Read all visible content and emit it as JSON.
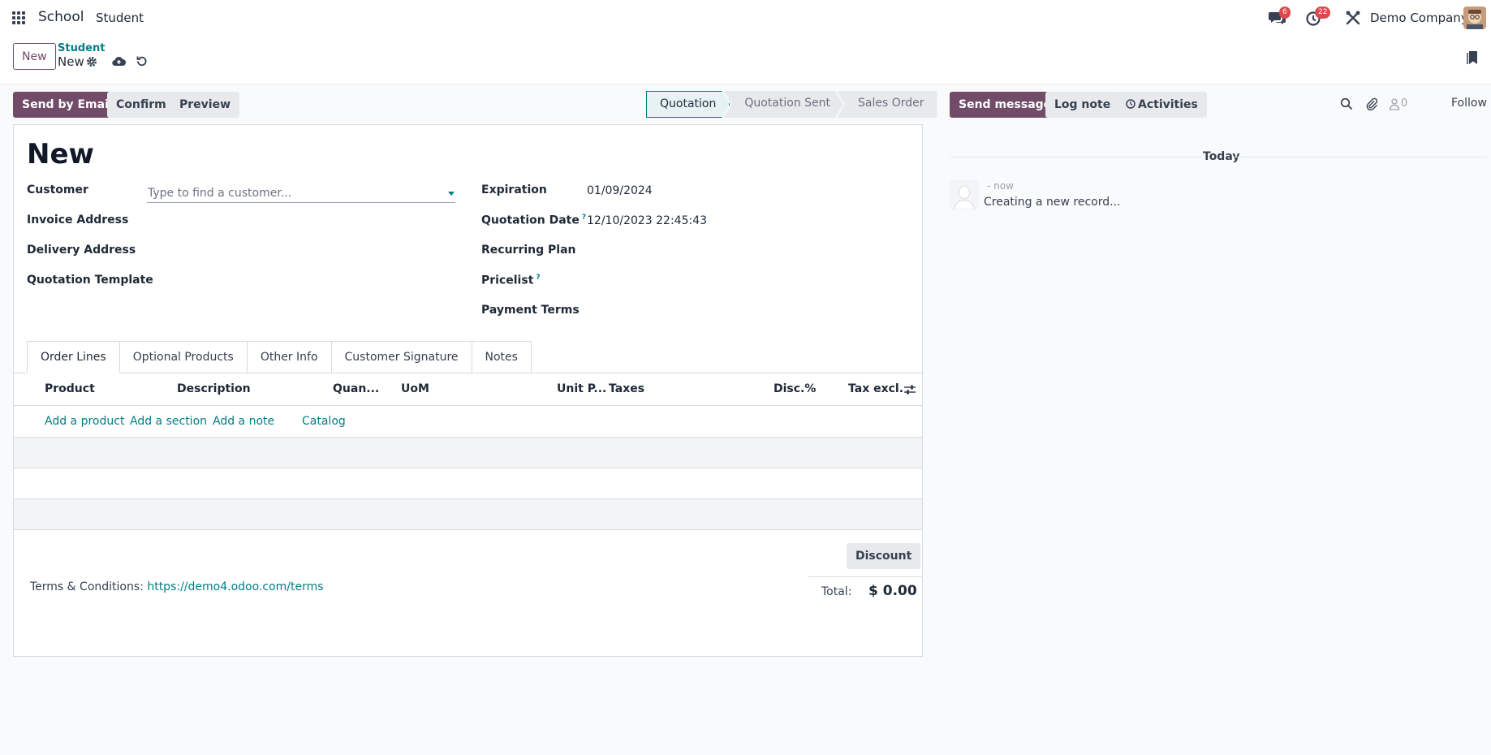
{
  "topbar": {
    "brand": "School",
    "menu_item": "Student",
    "messages_count": "6",
    "activities_count": "22",
    "company": "Demo Company"
  },
  "controlbar": {
    "new_button": "New",
    "breadcrumb_parent": "Student",
    "breadcrumb_current": "New"
  },
  "actions": {
    "send_email": "Send by Email",
    "confirm": "Confirm",
    "preview": "Preview"
  },
  "status": {
    "stages": [
      "Quotation",
      "Quotation Sent",
      "Sales Order"
    ],
    "active": "Quotation"
  },
  "form": {
    "title": "New",
    "customer_label": "Customer",
    "customer_placeholder": "Type to find a customer...",
    "invoice_address_label": "Invoice Address",
    "delivery_address_label": "Delivery Address",
    "quotation_template_label": "Quotation Template",
    "expiration_label": "Expiration",
    "expiration_value": "01/09/2024",
    "quotation_date_label": "Quotation Date",
    "quotation_date_value": "12/10/2023 22:45:43",
    "recurring_plan_label": "Recurring Plan",
    "pricelist_label": "Pricelist",
    "payment_terms_label": "Payment Terms",
    "help_mark": "?"
  },
  "tabs": [
    "Order Lines",
    "Optional Products",
    "Other Info",
    "Customer Signature",
    "Notes"
  ],
  "table": {
    "columns": [
      "Product",
      "Description",
      "Quan...",
      "UoM",
      "Unit P...",
      "Taxes",
      "Disc.%",
      "Tax excl."
    ],
    "add_links": [
      "Add a product",
      "Add a section",
      "Add a note",
      "Catalog"
    ]
  },
  "footer": {
    "discount_button": "Discount",
    "total_label": "Total:",
    "total_value": "$ 0.00",
    "terms_label": "Terms & Conditions:",
    "terms_link": "https://demo4.odoo.com/terms"
  },
  "chatter": {
    "send_message": "Send message",
    "log_note": "Log note",
    "activities": "Activities",
    "followers_count": "0",
    "follow": "Follow",
    "today": "Today",
    "message_time": "- now",
    "message_body": "Creating a new record..."
  },
  "colors": {
    "primary": "#714b67",
    "link": "#017e84",
    "badge": "#e0474c"
  }
}
